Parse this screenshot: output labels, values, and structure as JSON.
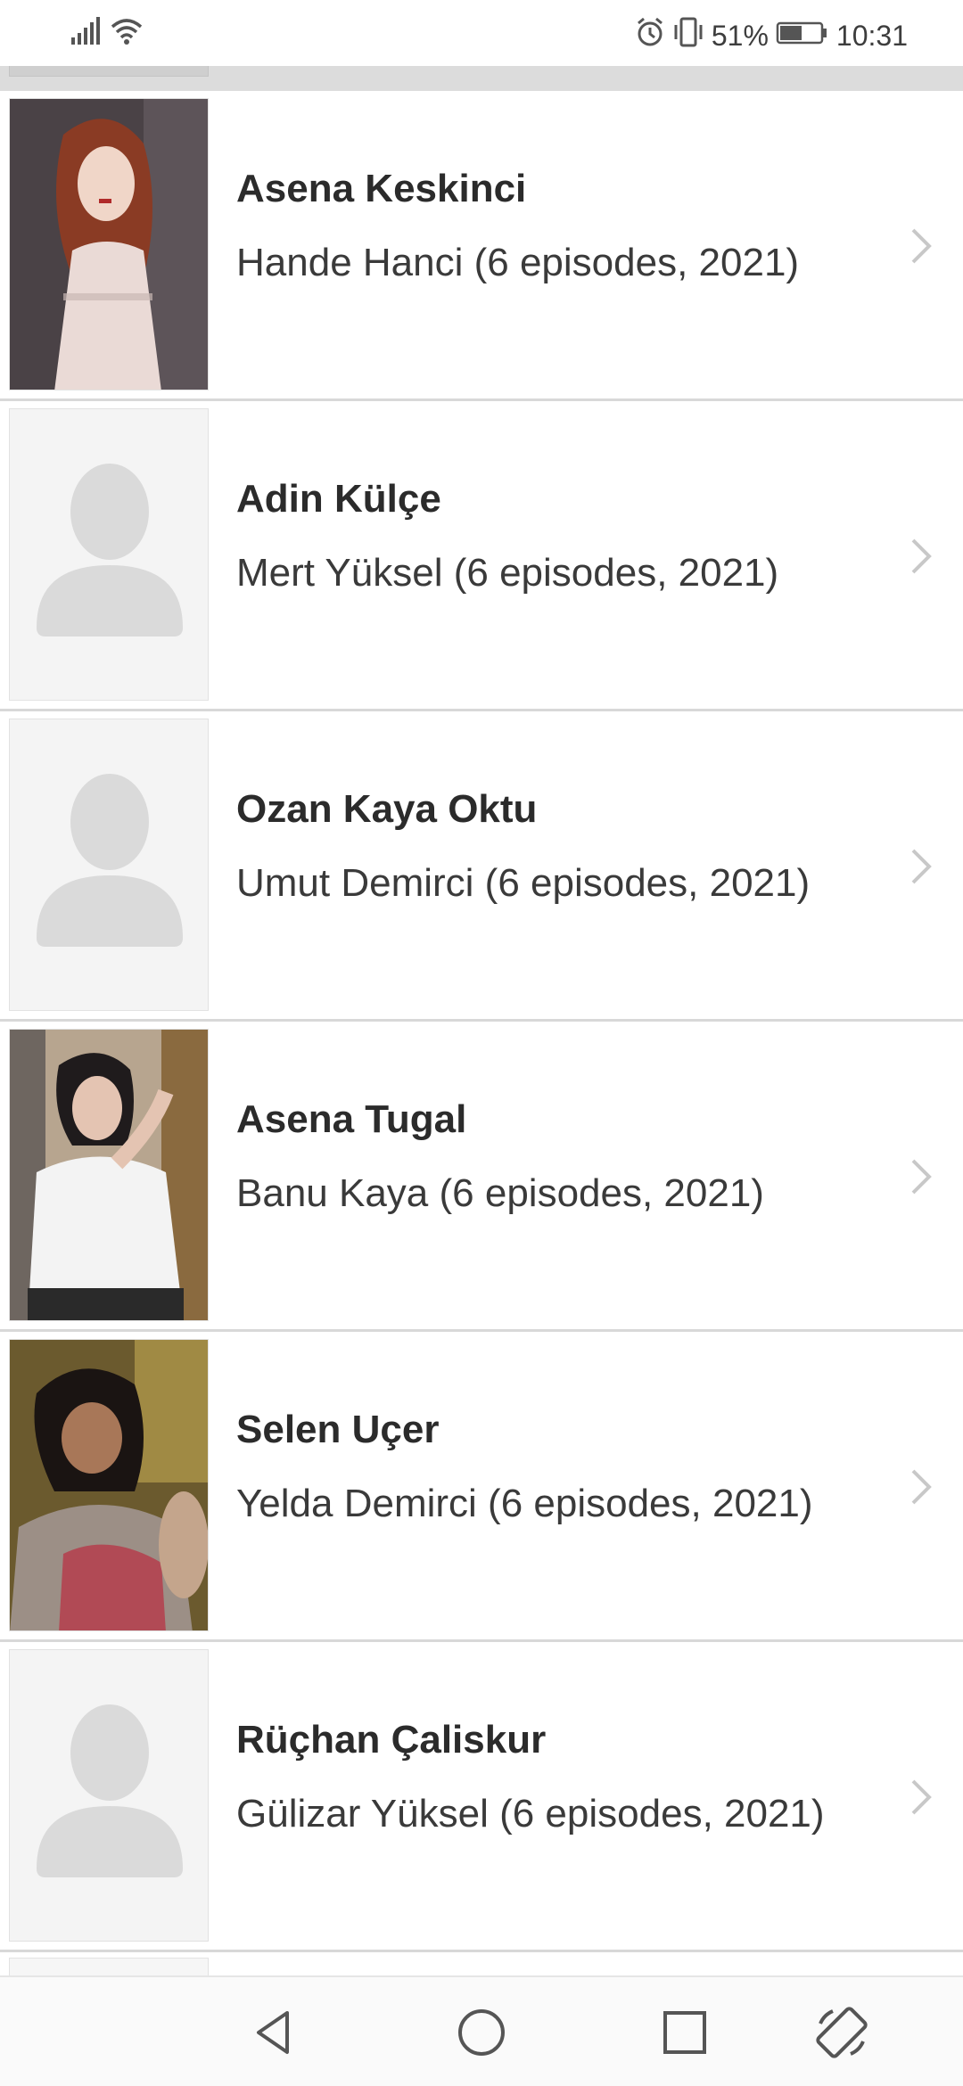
{
  "status_bar": {
    "battery_percent": "51%",
    "time": "10:31",
    "icons": [
      "signal-icon",
      "wifi-icon",
      "alarm-icon",
      "vibrate-icon",
      "battery-icon"
    ]
  },
  "cast": [
    {
      "actor": "Asena Keskinci",
      "role": "Hande Hanci (6 episodes, 2021)",
      "has_photo": true,
      "photo": "woman-red-hair"
    },
    {
      "actor": "Adin Külçe",
      "role": "Mert Yüksel (6 episodes, 2021)",
      "has_photo": false
    },
    {
      "actor": "Ozan Kaya Oktu",
      "role": "Umut Demirci (6 episodes, 2021)",
      "has_photo": false
    },
    {
      "actor": "Asena Tugal",
      "role": "Banu Kaya (6 episodes, 2021)",
      "has_photo": true,
      "photo": "woman-white-shirt"
    },
    {
      "actor": "Selen Uçer",
      "role": "Yelda Demirci (6 episodes, 2021)",
      "has_photo": true,
      "photo": "woman-dark-hair"
    },
    {
      "actor": "Rüçhan Çaliskur",
      "role": "Gülizar Yüksel (6 episodes, 2021)",
      "has_photo": false
    }
  ],
  "nav_bar": {
    "buttons": [
      "back-icon",
      "home-icon",
      "recents-icon",
      "rotate-icon"
    ]
  },
  "colors": {
    "divider": "#d8d8d8",
    "text_primary": "#2b2b2b",
    "chevron": "#c8c8c8",
    "placeholder": "#dadada"
  }
}
